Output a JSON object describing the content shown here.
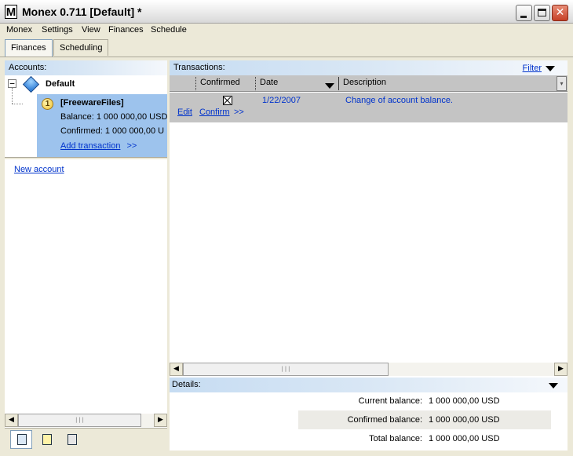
{
  "window": {
    "icon_letter": "M",
    "title": "Monex 0.711 [Default] *",
    "close_glyph": "✕"
  },
  "menu": [
    "Monex",
    "Settings",
    "View",
    "Finances",
    "Schedule"
  ],
  "tabs": [
    "Finances",
    "Scheduling"
  ],
  "accounts": {
    "header": "Accounts:",
    "tree_expander": "−",
    "root_label": "Default",
    "account": {
      "badge": "1",
      "name": "[FreewareFiles]",
      "balance_label": "Balance:",
      "balance_value": "1 000 000,00 USD",
      "confirmed_label": "Confirmed:",
      "confirmed_value": "1 000 000,00 U",
      "add_transaction": "Add transaction",
      "add_arrows": ">>"
    },
    "new_account": "New account"
  },
  "transactions": {
    "header": "Transactions:",
    "filter_label": "Filter",
    "columns": [
      "Confirmed",
      "Date",
      "Description"
    ],
    "rows": [
      {
        "confirmed": true,
        "date": "1/22/2007",
        "description": "Change of account balance.",
        "edit": "Edit",
        "confirm": "Confirm",
        "more": ">>"
      }
    ]
  },
  "details": {
    "header": "Details:",
    "balances": [
      {
        "label": "Current balance:",
        "value": "1 000 000,00  USD"
      },
      {
        "label": "Confirmed balance:",
        "value": "1 000 000,00  USD"
      },
      {
        "label": "Total balance:",
        "value": "1 000 000,00  USD"
      }
    ]
  },
  "scroll": {
    "left_arrow": "◀",
    "right_arrow": "▶",
    "grip": "|||"
  },
  "colors": {
    "selection_blue": "#9dc3ed",
    "link_blue": "#0033cc",
    "row_gray": "#c4c4c4"
  }
}
